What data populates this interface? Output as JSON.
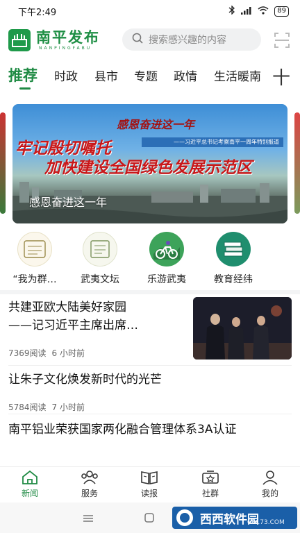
{
  "status_bar": {
    "time": "下午2:49",
    "battery": "89"
  },
  "header": {
    "logo_text": "南平发布",
    "logo_subtext": "NANPINGFABU",
    "search_placeholder": "搜索感兴趣的内容"
  },
  "tabs": [
    {
      "label": "推荐",
      "active": true
    },
    {
      "label": "时政"
    },
    {
      "label": "县市"
    },
    {
      "label": "专题"
    },
    {
      "label": "政情"
    },
    {
      "label": "生活暖南"
    }
  ],
  "tab_add": "十",
  "banner": {
    "kicker": "感恩奋进这一年",
    "strip": "——习近平总书记考察南平一周年特别报道",
    "headline_1": "牢记殷切嘱托",
    "headline_2": "加快建设全国绿色发展示范区",
    "caption": "感恩奋进这一年"
  },
  "quick_entries": [
    {
      "label": "“我为群…",
      "icon": "volunteer-stamp-icon"
    },
    {
      "label": "武夷文坛",
      "icon": "wuyi-forum-stamp-icon"
    },
    {
      "label": "乐游武夷",
      "icon": "cycling-icon"
    },
    {
      "label": "教育经纬",
      "icon": "books-icon"
    }
  ],
  "articles": [
    {
      "title_line1": "共建亚欧大陆美好家园",
      "title_line2": "——记习近平主席出席…",
      "reads": "7369阅读",
      "time": "6 小时前",
      "has_thumb": true
    },
    {
      "title": "让朱子文化焕发新时代的光芒",
      "reads": "5784阅读",
      "time": "7 小时前"
    },
    {
      "title": "南平铝业荣获国家两化融合管理体系3A认证"
    }
  ],
  "bottom_nav": [
    {
      "label": "新闻",
      "icon": "home-icon",
      "active": true
    },
    {
      "label": "服务",
      "icon": "service-icon"
    },
    {
      "label": "读报",
      "icon": "newspaper-icon"
    },
    {
      "label": "社群",
      "icon": "community-icon"
    },
    {
      "label": "我的",
      "icon": "profile-icon"
    }
  ],
  "watermark": {
    "brand": "西西软件园",
    "site": "CR173.COM"
  },
  "colors": {
    "accent": "#1e8a43",
    "banner_red": "#c8181a"
  }
}
